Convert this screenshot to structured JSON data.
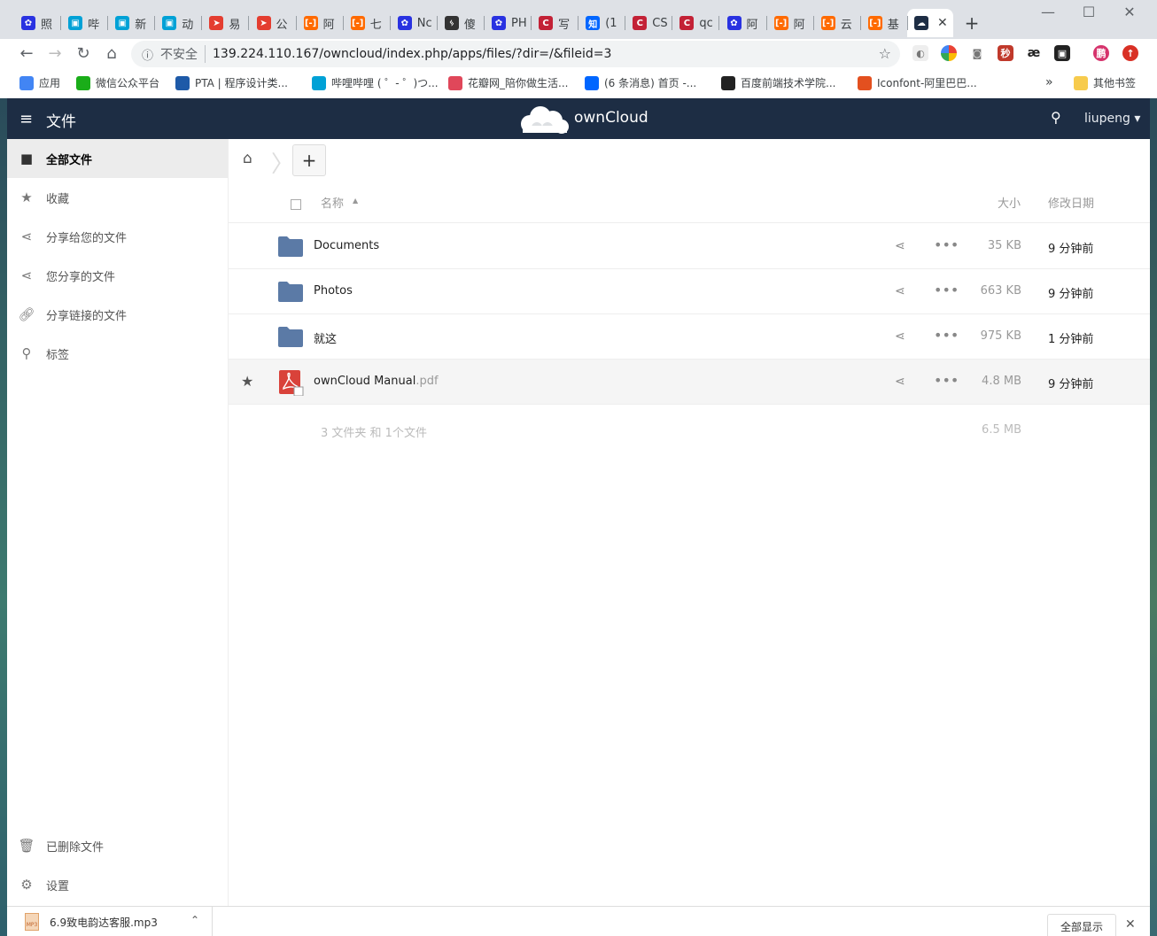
{
  "browser": {
    "tabs": [
      {
        "title": "照",
        "icon": "baidu-paw-icon",
        "color": "#2932e1"
      },
      {
        "title": "哔",
        "icon": "bilibili-icon",
        "color": "#00a1d6"
      },
      {
        "title": "新",
        "icon": "bilibili-icon",
        "color": "#00a1d6"
      },
      {
        "title": "动",
        "icon": "bilibili-icon",
        "color": "#00a1d6"
      },
      {
        "title": "易",
        "icon": "arrow-logo-icon",
        "color": "#e43d30"
      },
      {
        "title": "公",
        "icon": "arrow-logo-icon",
        "color": "#e43d30"
      },
      {
        "title": "阿",
        "icon": "aliyun-icon",
        "color": "#ff6a00"
      },
      {
        "title": "七",
        "icon": "aliyun-icon",
        "color": "#ff6a00"
      },
      {
        "title": "Nc",
        "icon": "baidu-paw-icon",
        "color": "#2932e1"
      },
      {
        "title": "傻",
        "icon": "feather-icon",
        "color": "#333333"
      },
      {
        "title": "PH",
        "icon": "baidu-paw-icon",
        "color": "#2932e1"
      },
      {
        "title": "写",
        "icon": "csdn-icon",
        "color": "#c32136"
      },
      {
        "title": "(1",
        "icon": "zhihu-icon",
        "color": "#0066ff"
      },
      {
        "title": "CS",
        "icon": "csdn-icon",
        "color": "#c32136"
      },
      {
        "title": "qc",
        "icon": "csdn-icon",
        "color": "#c32136"
      },
      {
        "title": "阿",
        "icon": "baidu-paw-icon",
        "color": "#2932e1"
      },
      {
        "title": "阿",
        "icon": "aliyun-icon",
        "color": "#ff6a00"
      },
      {
        "title": "云",
        "icon": "aliyun-icon",
        "color": "#ff6a00"
      },
      {
        "title": "基",
        "icon": "aliyun-icon",
        "color": "#ff6a00"
      }
    ],
    "active_tab_icon": "owncloud-icon",
    "url_insecure_label": "不安全",
    "url": "139.224.110.167/owncloud/index.php/apps/files/?dir=/&fileid=3",
    "bookmarks": [
      {
        "label": "应用",
        "icon": "apps-grid-icon",
        "color": "#4285f4"
      },
      {
        "label": "微信公众平台",
        "icon": "wechat-icon",
        "color": "#1aad19"
      },
      {
        "label": "PTA | 程序设计类...",
        "icon": "pta-icon",
        "color": "#1e5aa8"
      },
      {
        "label": "哔哩哔哩 ( ゜- ゜)つ...",
        "icon": "bilibili-icon",
        "color": "#00a1d6"
      },
      {
        "label": "花瓣网_陪你做生活...",
        "icon": "huaban-icon",
        "color": "#e0475a"
      },
      {
        "label": "(6 条消息) 首页 -...",
        "icon": "zhihu-icon",
        "color": "#0066ff"
      },
      {
        "label": "百度前端技术学院...",
        "icon": "ife-icon",
        "color": "#222222"
      },
      {
        "label": "Iconfont-阿里巴巴...",
        "icon": "iconfont-icon",
        "color": "#e3501f"
      }
    ],
    "bookmarks_overflow": "»",
    "other_bookmarks": "其他书签"
  },
  "owncloud": {
    "app_title": "文件",
    "brand": "ownCloud",
    "user": "liupeng",
    "nav": {
      "items": [
        {
          "label": "全部文件",
          "icon": "folder-icon"
        },
        {
          "label": "收藏",
          "icon": "star-icon"
        },
        {
          "label": "分享给您的文件",
          "icon": "share-icon"
        },
        {
          "label": "您分享的文件",
          "icon": "share-icon"
        },
        {
          "label": "分享链接的文件",
          "icon": "link-icon"
        },
        {
          "label": "标签",
          "icon": "search-icon"
        }
      ],
      "trash": "已删除文件",
      "settings": "设置"
    },
    "table": {
      "col_name": "名称",
      "col_size": "大小",
      "col_modified": "修改日期",
      "rows": [
        {
          "name": "Documents",
          "ext": "",
          "type": "folder",
          "size": "35 KB",
          "modified": "9 分钟前",
          "favorite": false
        },
        {
          "name": "Photos",
          "ext": "",
          "type": "folder",
          "size": "663 KB",
          "modified": "9 分钟前",
          "favorite": false
        },
        {
          "name": "就这",
          "ext": "",
          "type": "folder",
          "size": "975 KB",
          "modified": "1 分钟前",
          "favorite": false
        },
        {
          "name": "ownCloud Manual",
          "ext": ".pdf",
          "type": "pdf",
          "size": "4.8 MB",
          "modified": "9 分钟前",
          "favorite": true
        }
      ],
      "summary_text": "3 文件夹 和 1个文件",
      "summary_size": "6.5 MB"
    },
    "colors": {
      "header": "#1d2d44",
      "folder": "#5b7aa6",
      "pdf": "#d9423a"
    }
  },
  "downloads": {
    "file_name": "6.9致电韵达客服.mp3",
    "file_badge": "MP3",
    "show_all": "全部显示"
  }
}
